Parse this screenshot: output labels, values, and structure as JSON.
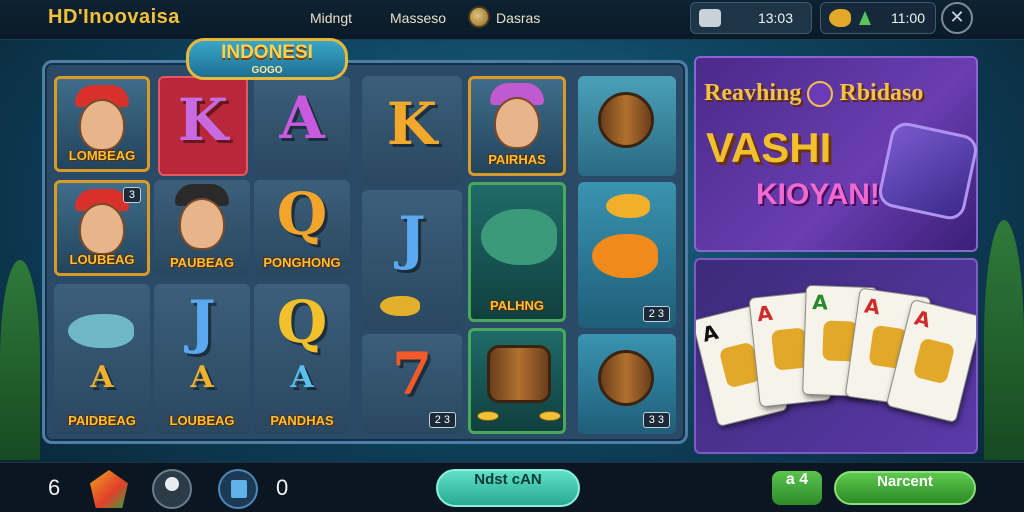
{
  "topbar": {
    "brand": "HD'Inoovaisa",
    "nav": [
      "Midngt",
      "Masseso",
      "Dasras"
    ],
    "balance": "13:03",
    "wallet": "11:00",
    "close_glyph": "✕"
  },
  "game": {
    "logo_title": "INDONESI",
    "logo_sub": "GOGO",
    "reels": [
      {
        "cells": [
          "LOMBEAG",
          "LOUBEAG",
          ""
        ]
      },
      {
        "cells": [
          "K",
          "PAUBEAG",
          "J"
        ]
      },
      {
        "cells": [
          "A",
          "PONGHONG",
          "Q"
        ]
      },
      {
        "cells": [
          "K",
          "J",
          "7"
        ]
      },
      {
        "cells": [
          "PAIRHAS",
          "PALHNG",
          ""
        ]
      },
      {
        "cells": [
          "",
          "",
          ""
        ]
      }
    ],
    "bottom_labels": [
      "PAIDBEAG",
      "LOUBEAG",
      "PANDHAS"
    ],
    "badges": [
      "2 3",
      "2 3",
      "3 3"
    ],
    "corner_badge": "3"
  },
  "promo": {
    "line1": "Reavhing",
    "line1b": "Rbidaso",
    "line2": "VASHI",
    "line3": "KIOYAN!"
  },
  "cards": [
    "A",
    "A",
    "A",
    "A",
    "A"
  ],
  "bottombar": {
    "count": "6",
    "credit": "0",
    "main_button": "Ndst cAN",
    "small_button": "a 4",
    "next_button": "Narcent"
  },
  "colors": {
    "accent": "#f2c13a",
    "button_teal": "#3cc6ae",
    "button_green": "#3fa834"
  }
}
